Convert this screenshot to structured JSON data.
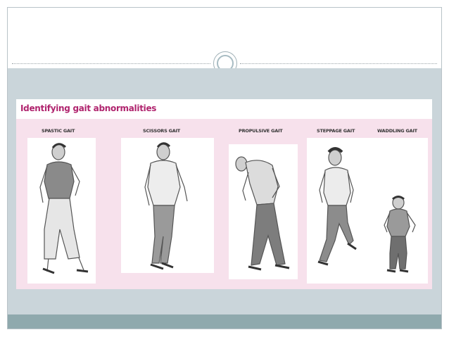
{
  "figure": {
    "title": "Identifying gait abnormalities",
    "gaits": [
      {
        "label": "SPASTIC GAIT",
        "icon": "spastic-gait-figure-icon"
      },
      {
        "label": "SCISSORS GAIT",
        "icon": "scissors-gait-figure-icon"
      },
      {
        "label": "PROPULSIVE GAIT",
        "icon": "propulsive-gait-figure-icon"
      },
      {
        "label": "STEPPAGE GAIT",
        "icon": "steppage-gait-figure-icon"
      },
      {
        "label": "WADDLING GAIT",
        "icon": "waddling-gait-figure-icon"
      }
    ]
  },
  "colors": {
    "title": "#b0246e",
    "panel_background": "#f7e1ec",
    "body_band": "#cad5da",
    "footer_band": "#8fa9ad"
  }
}
